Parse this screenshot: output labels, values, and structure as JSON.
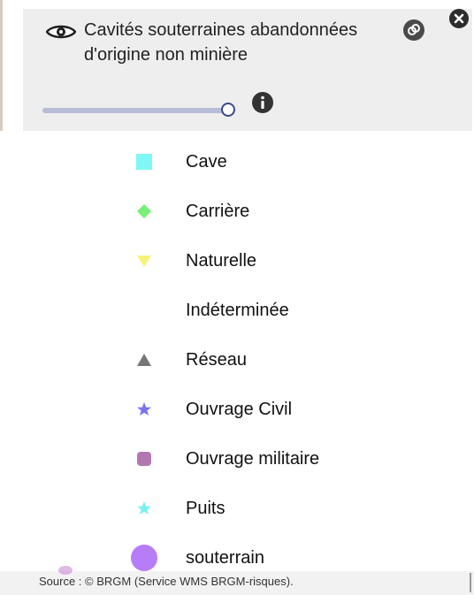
{
  "layer": {
    "title": "Cavités souterraines abandonnées d'origine non minière",
    "opacity_fraction": 1.0,
    "icons": {
      "visibility": "eye-icon",
      "link": "link-icon",
      "close": "close-icon",
      "info": "info-icon"
    }
  },
  "legend": {
    "items": [
      {
        "label": "Cave",
        "symbol": "square",
        "color": "#7ff7f5"
      },
      {
        "label": "Carrière",
        "symbol": "diamond",
        "color": "#77f077"
      },
      {
        "label": "Naturelle",
        "symbol": "triangle-down",
        "color": "#f7f27a"
      },
      {
        "label": "Indéterminée",
        "symbol": "none",
        "color": "#ffffff"
      },
      {
        "label": "Réseau",
        "symbol": "triangle-up",
        "color": "#777777"
      },
      {
        "label": "Ouvrage Civil",
        "symbol": "star",
        "color": "#7a73ef"
      },
      {
        "label": "Ouvrage militaire",
        "symbol": "rounded-square",
        "color": "#b277b2"
      },
      {
        "label": "Puits",
        "symbol": "star",
        "color": "#78f1f1"
      },
      {
        "label": "souterrain",
        "symbol": "circle",
        "color": "#b77cf7"
      }
    ]
  },
  "footer": {
    "source": "Source : © BRGM (Service WMS BRGM-risques)."
  }
}
